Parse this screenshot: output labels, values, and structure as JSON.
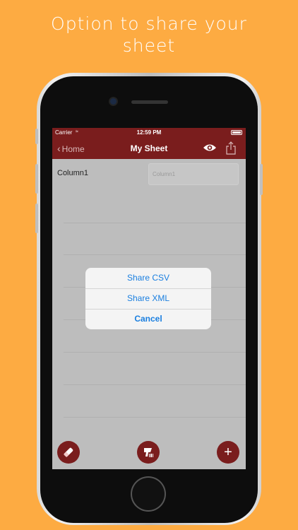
{
  "headline": {
    "line1": "Option to share your",
    "line2": "sheet"
  },
  "status_bar": {
    "carrier": "Carrier",
    "time": "12:59 PM"
  },
  "nav": {
    "back_label": "Home",
    "title": "My Sheet"
  },
  "sheet": {
    "row_label": "Column1",
    "input_placeholder": "Column1"
  },
  "alert": {
    "share_csv": "Share CSV",
    "share_xml": "Share XML",
    "cancel": "Cancel"
  },
  "icons": {
    "back": "chevron-left-icon",
    "eye": "eye-icon",
    "share": "share-icon",
    "eraser": "eraser-icon",
    "scanner": "barcode-scanner-icon",
    "add": "plus-icon"
  },
  "colors": {
    "background": "#fdab42",
    "nav": "#7a1d1d",
    "accent": "#1a7fe0"
  }
}
